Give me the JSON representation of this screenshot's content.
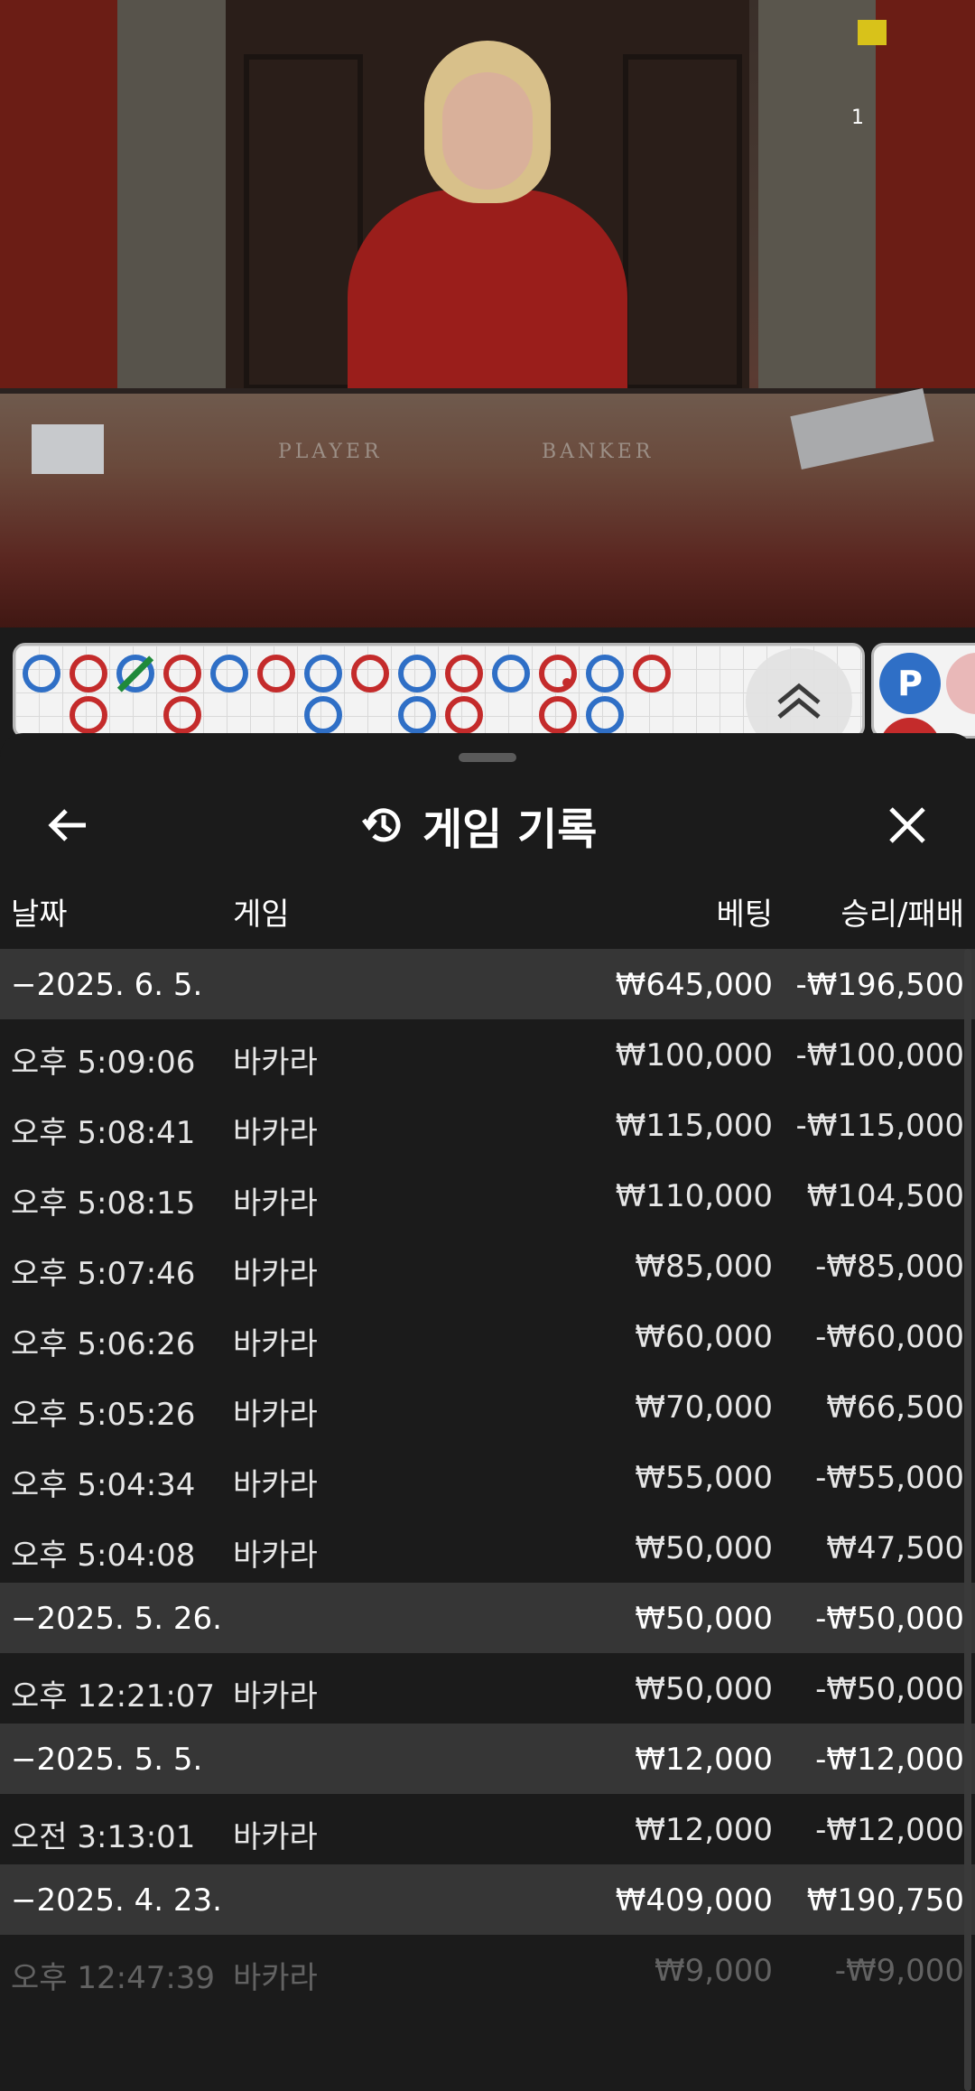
{
  "video": {
    "viewer_count": "1",
    "table_labels": {
      "player": "PLAYER",
      "banker": "BANKER"
    }
  },
  "road_map": {
    "top_row": [
      "P",
      "B",
      "P",
      "B",
      "P",
      "B",
      "P",
      "B",
      "P",
      "B",
      "P",
      "B",
      "P",
      "B"
    ],
    "bottom_row": [
      "",
      "B",
      "",
      "B",
      "",
      "",
      "P",
      "",
      "P",
      "B",
      "",
      "B",
      "P",
      ""
    ],
    "colors": {
      "player": "#2f6fc6",
      "banker": "#c42b2b",
      "tie": "#1f8a3a"
    },
    "predict_label": "P"
  },
  "sheet": {
    "title": "게임 기록",
    "columns": {
      "date": "날짜",
      "game": "게임",
      "bet": "베팅",
      "win_loss": "승리/패배"
    },
    "rows": [
      {
        "type": "group",
        "date": "−2025. 6. 5.",
        "game": "",
        "bet": "₩645,000",
        "win": "-₩196,500"
      },
      {
        "type": "item",
        "date": "오후 5:09:06",
        "game": "바카라",
        "bet": "₩100,000",
        "win": "-₩100,000"
      },
      {
        "type": "item",
        "date": "오후 5:08:41",
        "game": "바카라",
        "bet": "₩115,000",
        "win": "-₩115,000"
      },
      {
        "type": "item",
        "date": "오후 5:08:15",
        "game": "바카라",
        "bet": "₩110,000",
        "win": "₩104,500"
      },
      {
        "type": "item",
        "date": "오후 5:07:46",
        "game": "바카라",
        "bet": "₩85,000",
        "win": "-₩85,000"
      },
      {
        "type": "item",
        "date": "오후 5:06:26",
        "game": "바카라",
        "bet": "₩60,000",
        "win": "-₩60,000"
      },
      {
        "type": "item",
        "date": "오후 5:05:26",
        "game": "바카라",
        "bet": "₩70,000",
        "win": "₩66,500"
      },
      {
        "type": "item",
        "date": "오후 5:04:34",
        "game": "바카라",
        "bet": "₩55,000",
        "win": "-₩55,000"
      },
      {
        "type": "item",
        "date": "오후 5:04:08",
        "game": "바카라",
        "bet": "₩50,000",
        "win": "₩47,500"
      },
      {
        "type": "group",
        "date": "−2025. 5. 26.",
        "game": "",
        "bet": "₩50,000",
        "win": "-₩50,000"
      },
      {
        "type": "item",
        "date": "오후 12:21:07",
        "game": "바카라",
        "bet": "₩50,000",
        "win": "-₩50,000"
      },
      {
        "type": "group",
        "date": "−2025. 5. 5.",
        "game": "",
        "bet": "₩12,000",
        "win": "-₩12,000"
      },
      {
        "type": "item",
        "date": "오전 3:13:01",
        "game": "바카라",
        "bet": "₩12,000",
        "win": "-₩12,000"
      },
      {
        "type": "group",
        "date": "−2025. 4. 23.",
        "game": "",
        "bet": "₩409,000",
        "win": "₩190,750"
      },
      {
        "type": "item-faded",
        "date": "오후 12:47:39",
        "game": "바카라",
        "bet": "₩9,000",
        "win": "-₩9,000"
      }
    ]
  }
}
